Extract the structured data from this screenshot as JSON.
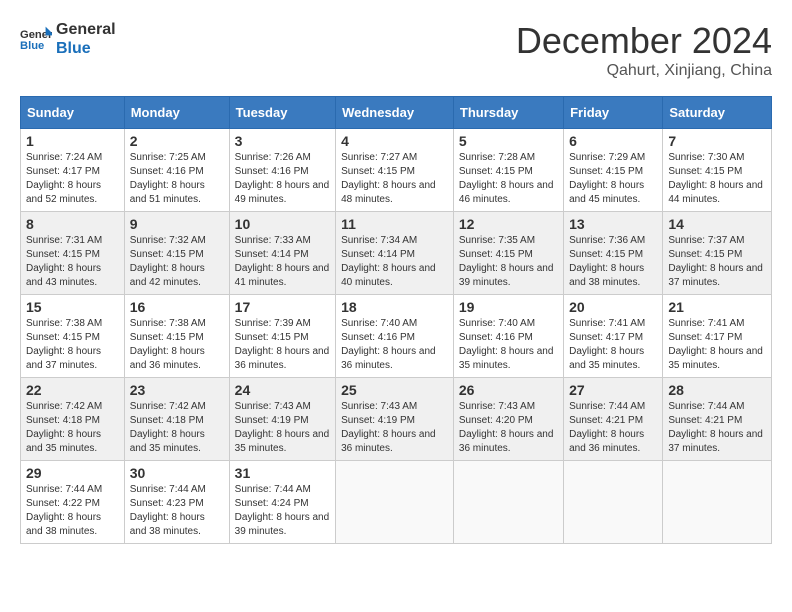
{
  "header": {
    "logo_line1": "General",
    "logo_line2": "Blue",
    "month": "December 2024",
    "location": "Qahurt, Xinjiang, China"
  },
  "days_of_week": [
    "Sunday",
    "Monday",
    "Tuesday",
    "Wednesday",
    "Thursday",
    "Friday",
    "Saturday"
  ],
  "weeks": [
    [
      {
        "day": "1",
        "sunrise": "7:24 AM",
        "sunset": "4:17 PM",
        "daylight": "8 hours and 52 minutes."
      },
      {
        "day": "2",
        "sunrise": "7:25 AM",
        "sunset": "4:16 PM",
        "daylight": "8 hours and 51 minutes."
      },
      {
        "day": "3",
        "sunrise": "7:26 AM",
        "sunset": "4:16 PM",
        "daylight": "8 hours and 49 minutes."
      },
      {
        "day": "4",
        "sunrise": "7:27 AM",
        "sunset": "4:15 PM",
        "daylight": "8 hours and 48 minutes."
      },
      {
        "day": "5",
        "sunrise": "7:28 AM",
        "sunset": "4:15 PM",
        "daylight": "8 hours and 46 minutes."
      },
      {
        "day": "6",
        "sunrise": "7:29 AM",
        "sunset": "4:15 PM",
        "daylight": "8 hours and 45 minutes."
      },
      {
        "day": "7",
        "sunrise": "7:30 AM",
        "sunset": "4:15 PM",
        "daylight": "8 hours and 44 minutes."
      }
    ],
    [
      {
        "day": "8",
        "sunrise": "7:31 AM",
        "sunset": "4:15 PM",
        "daylight": "8 hours and 43 minutes."
      },
      {
        "day": "9",
        "sunrise": "7:32 AM",
        "sunset": "4:15 PM",
        "daylight": "8 hours and 42 minutes."
      },
      {
        "day": "10",
        "sunrise": "7:33 AM",
        "sunset": "4:14 PM",
        "daylight": "8 hours and 41 minutes."
      },
      {
        "day": "11",
        "sunrise": "7:34 AM",
        "sunset": "4:14 PM",
        "daylight": "8 hours and 40 minutes."
      },
      {
        "day": "12",
        "sunrise": "7:35 AM",
        "sunset": "4:15 PM",
        "daylight": "8 hours and 39 minutes."
      },
      {
        "day": "13",
        "sunrise": "7:36 AM",
        "sunset": "4:15 PM",
        "daylight": "8 hours and 38 minutes."
      },
      {
        "day": "14",
        "sunrise": "7:37 AM",
        "sunset": "4:15 PM",
        "daylight": "8 hours and 37 minutes."
      }
    ],
    [
      {
        "day": "15",
        "sunrise": "7:38 AM",
        "sunset": "4:15 PM",
        "daylight": "8 hours and 37 minutes."
      },
      {
        "day": "16",
        "sunrise": "7:38 AM",
        "sunset": "4:15 PM",
        "daylight": "8 hours and 36 minutes."
      },
      {
        "day": "17",
        "sunrise": "7:39 AM",
        "sunset": "4:15 PM",
        "daylight": "8 hours and 36 minutes."
      },
      {
        "day": "18",
        "sunrise": "7:40 AM",
        "sunset": "4:16 PM",
        "daylight": "8 hours and 36 minutes."
      },
      {
        "day": "19",
        "sunrise": "7:40 AM",
        "sunset": "4:16 PM",
        "daylight": "8 hours and 35 minutes."
      },
      {
        "day": "20",
        "sunrise": "7:41 AM",
        "sunset": "4:17 PM",
        "daylight": "8 hours and 35 minutes."
      },
      {
        "day": "21",
        "sunrise": "7:41 AM",
        "sunset": "4:17 PM",
        "daylight": "8 hours and 35 minutes."
      }
    ],
    [
      {
        "day": "22",
        "sunrise": "7:42 AM",
        "sunset": "4:18 PM",
        "daylight": "8 hours and 35 minutes."
      },
      {
        "day": "23",
        "sunrise": "7:42 AM",
        "sunset": "4:18 PM",
        "daylight": "8 hours and 35 minutes."
      },
      {
        "day": "24",
        "sunrise": "7:43 AM",
        "sunset": "4:19 PM",
        "daylight": "8 hours and 35 minutes."
      },
      {
        "day": "25",
        "sunrise": "7:43 AM",
        "sunset": "4:19 PM",
        "daylight": "8 hours and 36 minutes."
      },
      {
        "day": "26",
        "sunrise": "7:43 AM",
        "sunset": "4:20 PM",
        "daylight": "8 hours and 36 minutes."
      },
      {
        "day": "27",
        "sunrise": "7:44 AM",
        "sunset": "4:21 PM",
        "daylight": "8 hours and 36 minutes."
      },
      {
        "day": "28",
        "sunrise": "7:44 AM",
        "sunset": "4:21 PM",
        "daylight": "8 hours and 37 minutes."
      }
    ],
    [
      {
        "day": "29",
        "sunrise": "7:44 AM",
        "sunset": "4:22 PM",
        "daylight": "8 hours and 38 minutes."
      },
      {
        "day": "30",
        "sunrise": "7:44 AM",
        "sunset": "4:23 PM",
        "daylight": "8 hours and 38 minutes."
      },
      {
        "day": "31",
        "sunrise": "7:44 AM",
        "sunset": "4:24 PM",
        "daylight": "8 hours and 39 minutes."
      },
      null,
      null,
      null,
      null
    ]
  ],
  "labels": {
    "sunrise": "Sunrise:",
    "sunset": "Sunset:",
    "daylight": "Daylight:"
  }
}
